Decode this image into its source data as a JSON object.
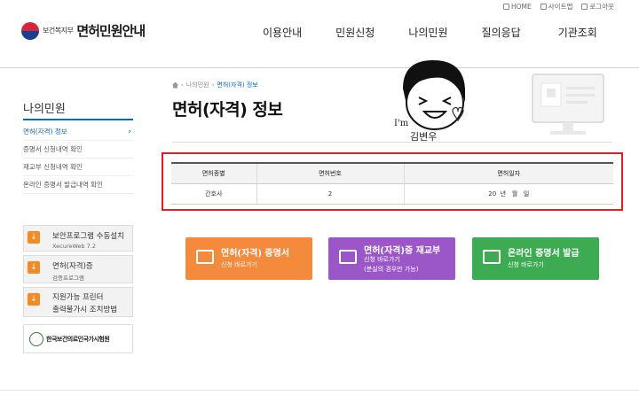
{
  "utility": {
    "home": "HOME",
    "sitemap": "사이트맵",
    "logout": "로그아웃"
  },
  "header": {
    "ministry": "보건복지부",
    "site_title": "면허민원안내"
  },
  "gnb": [
    "이용안내",
    "민원신청",
    "나의민원",
    "질의응답",
    "기관조회"
  ],
  "sidebar": {
    "title": "나의민원",
    "items": [
      {
        "label": "면허(자격) 정보",
        "active": true
      },
      {
        "label": "증명서 신청내역 확인"
      },
      {
        "label": "재교부 신청내역 확인"
      },
      {
        "label": "온라인 증명서 발급내역 확인"
      }
    ],
    "buttons": [
      {
        "line1": "보안프로그램 수동설치",
        "line2": "XecureWeb 7.2"
      },
      {
        "line1": "면허(자격)증",
        "line2": "검증프로그램"
      },
      {
        "line1": "지원가능 프린터",
        "line2": "출력불가시 조치방법"
      }
    ],
    "association": "한국보건의료인국가시험원"
  },
  "breadcrumb": [
    "나의민원",
    "면허(자격) 정보"
  ],
  "page_title": "면허(자격) 정보",
  "doodle": {
    "line1": "I'm",
    "line2": "김변우"
  },
  "table": {
    "headers": [
      "면허종별",
      "면허번호",
      "면허일자"
    ],
    "rows": [
      [
        "간호사",
        "2",
        "20  년   월   일"
      ]
    ]
  },
  "cta": [
    {
      "title": "면허(자격) 증명서",
      "sub": "신청 바로가기",
      "color": "#f48a3c"
    },
    {
      "title": "면허(자격)증 재교부",
      "sub": "신청 바로가기",
      "note": "(분실의 경우만 가능)",
      "color": "#9b57c8"
    },
    {
      "title": "온라인 증명서 발급",
      "sub": "신청 바로가기",
      "color": "#3cab52"
    }
  ],
  "accent": "#0b6ab7",
  "highlight": "#e21d24"
}
